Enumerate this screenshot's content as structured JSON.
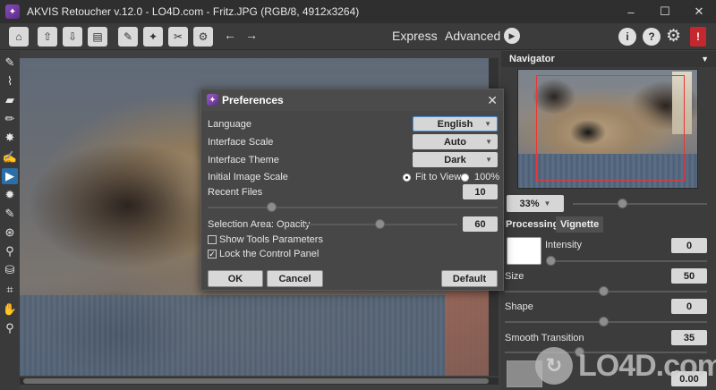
{
  "window": {
    "title": "AKVIS Retoucher v.12.0 - LO4D.com - Fritz.JPG (RGB/8, 4912x3264)"
  },
  "toolbar": {
    "express_label": "Express",
    "advanced_label": "Advanced"
  },
  "navigator": {
    "title": "Navigator",
    "zoom": "33%"
  },
  "panel": {
    "tabs": [
      "Processing",
      "Vignette"
    ],
    "intensity_label": "Intensity",
    "intensity_value": "0",
    "size_label": "Size",
    "size_value": "50",
    "shape_label": "Shape",
    "shape_value": "0",
    "smooth_label": "Smooth Transition",
    "smooth_value": "35",
    "extra_value": "0.00"
  },
  "dialog": {
    "title": "Preferences",
    "language_label": "Language",
    "language_value": "English",
    "scale_label": "Interface Scale",
    "scale_value": "Auto",
    "theme_label": "Interface Theme",
    "theme_value": "Dark",
    "image_scale_label": "Initial Image Scale",
    "fit_label": "Fit to View",
    "pct_label": "100%",
    "recent_label": "Recent Files",
    "recent_value": "10",
    "opacity_label": "Selection Area: Opacity",
    "opacity_value": "60",
    "show_tools_label": "Show Tools Parameters",
    "lock_panel_label": "Lock the Control Panel",
    "ok_label": "OK",
    "cancel_label": "Cancel",
    "default_label": "Default",
    "show_tools_checked": false,
    "lock_panel_checked": true,
    "initial_scale": "Fit to View"
  },
  "watermark": "LO4D.com"
}
